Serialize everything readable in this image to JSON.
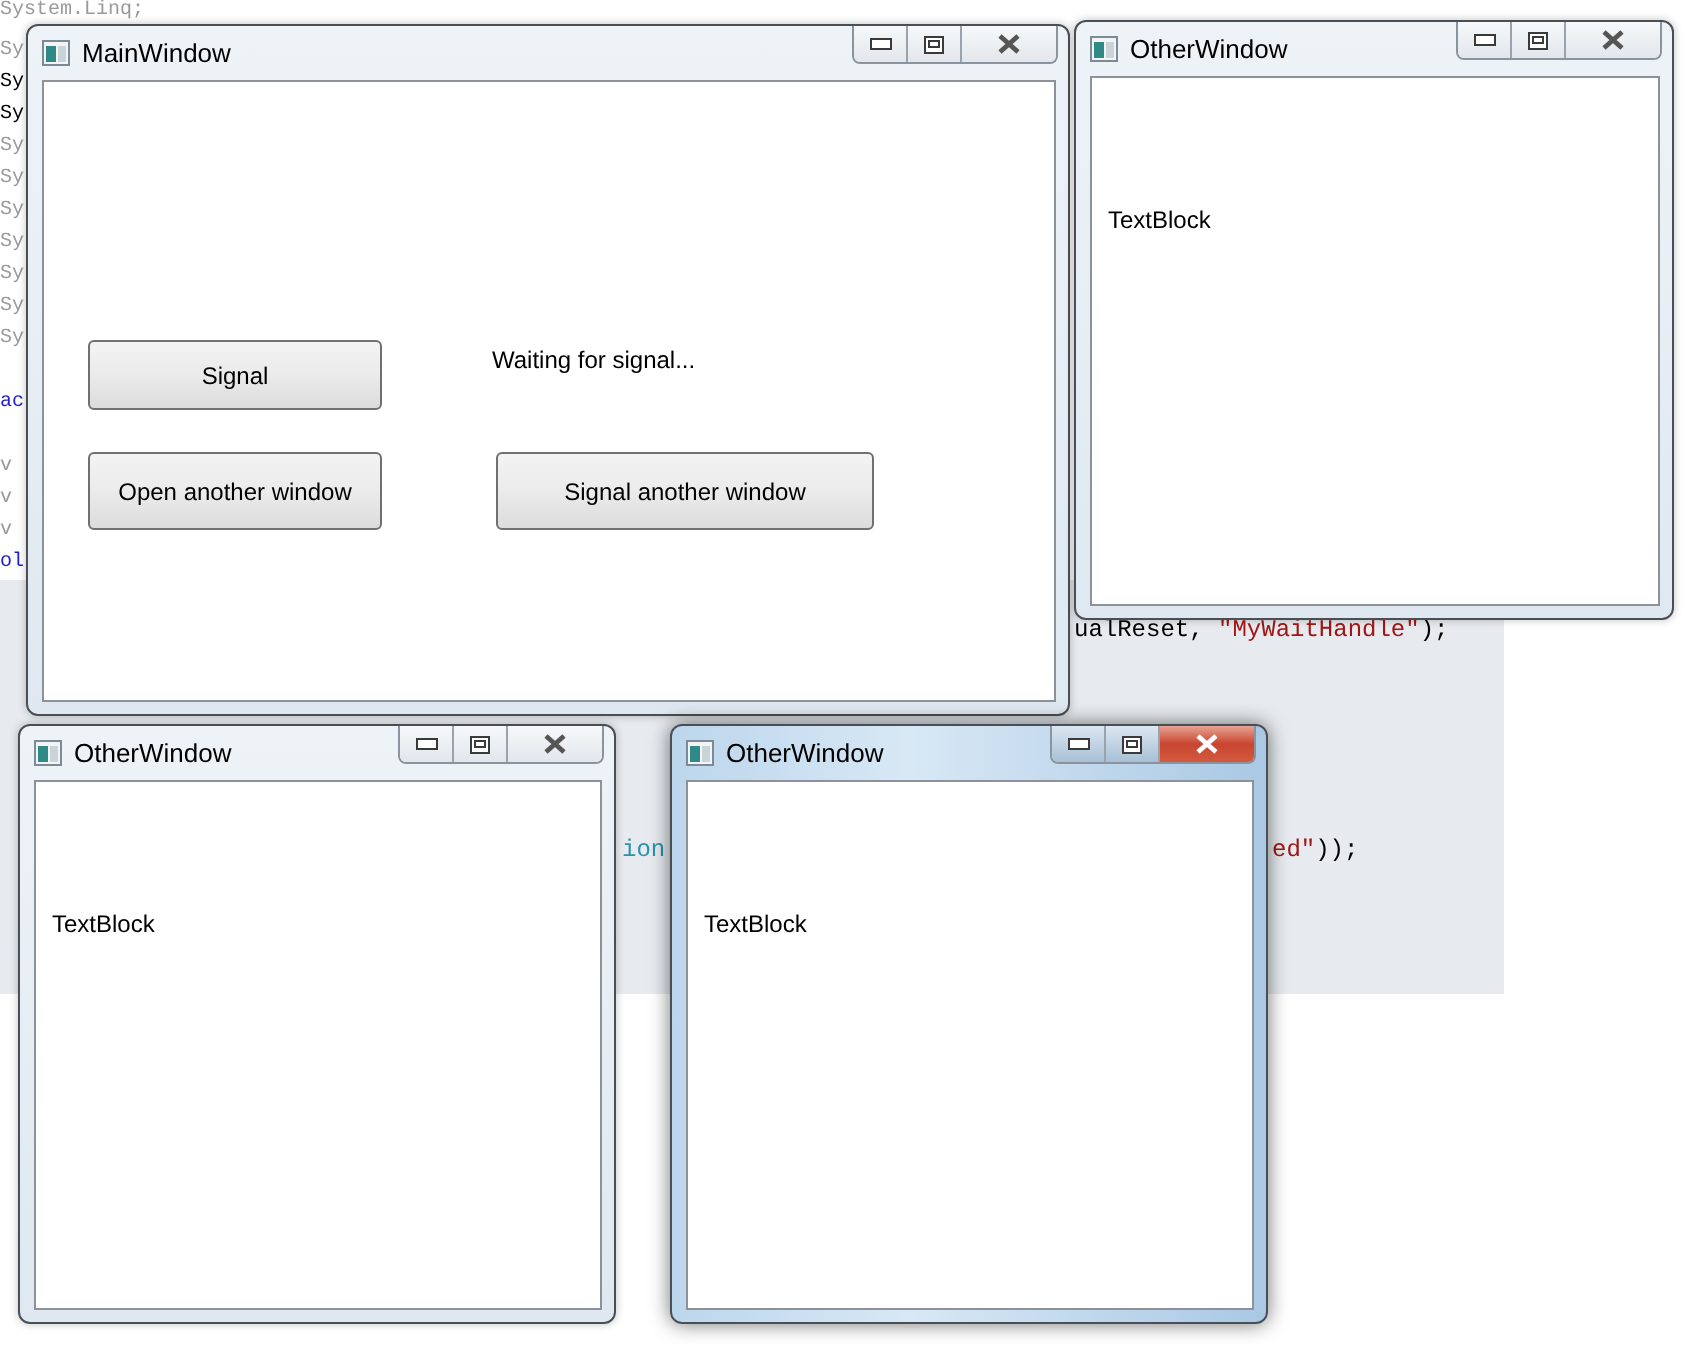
{
  "code_editor": {
    "lines": [
      {
        "segments": [
          {
            "text": "System.Linq;",
            "kind": "faded"
          }
        ]
      },
      {
        "segments": [
          {
            "text": "Sy",
            "kind": "faded"
          }
        ]
      },
      {
        "segments": [
          {
            "text": "Sy",
            "kind": "plain"
          }
        ]
      },
      {
        "segments": [
          {
            "text": "Sy",
            "kind": "plain"
          }
        ]
      },
      {
        "segments": [
          {
            "text": "Sy",
            "kind": "faded"
          }
        ]
      },
      {
        "segments": [
          {
            "text": "Sy",
            "kind": "faded"
          }
        ]
      },
      {
        "segments": [
          {
            "text": "Sy",
            "kind": "faded"
          }
        ]
      },
      {
        "segments": [
          {
            "text": "Sy",
            "kind": "faded"
          }
        ]
      },
      {
        "segments": [
          {
            "text": "Sy",
            "kind": "faded"
          }
        ]
      },
      {
        "segments": [
          {
            "text": "Sy",
            "kind": "faded"
          }
        ]
      },
      {
        "segments": [
          {
            "text": "Sy",
            "kind": "faded"
          }
        ]
      },
      {
        "segments": [
          {
            "text": "ac",
            "kind": "keyword"
          }
        ]
      },
      {
        "segments": [
          {
            "text": "v",
            "kind": "faded"
          }
        ]
      },
      {
        "segments": [
          {
            "text": "v",
            "kind": "faded"
          }
        ]
      },
      {
        "segments": [
          {
            "text": "v",
            "kind": "faded"
          }
        ]
      },
      {
        "segments": [
          {
            "text": "ol",
            "kind": "keyword"
          }
        ]
      },
      {
        "segments": [
          {
            "text": "ualReset, ",
            "kind": "plain"
          },
          {
            "text": "\"MyWaitHandle\"",
            "kind": "string"
          },
          {
            "text": ");",
            "kind": "plain"
          }
        ]
      },
      {
        "segments": [
          {
            "text": "ion",
            "kind": "type"
          }
        ]
      },
      {
        "segments": [
          {
            "text": "ed\"",
            "kind": "string"
          },
          {
            "text": "));",
            "kind": "plain"
          }
        ]
      }
    ]
  },
  "windows": [
    {
      "title": "MainWindow",
      "active": false,
      "content": {
        "kind": "main",
        "items": [
          {
            "kind": "button",
            "text": "Signal"
          },
          {
            "kind": "label",
            "text": "Waiting for signal..."
          },
          {
            "kind": "button",
            "text": "Open another window"
          },
          {
            "kind": "button",
            "text": "Signal another window"
          }
        ]
      }
    },
    {
      "title": "OtherWindow",
      "active": false,
      "content": {
        "kind": "text",
        "text": "TextBlock"
      }
    },
    {
      "title": "OtherWindow",
      "active": false,
      "content": {
        "kind": "text",
        "text": "TextBlock"
      }
    },
    {
      "title": "OtherWindow",
      "active": true,
      "content": {
        "kind": "text",
        "text": "TextBlock"
      }
    }
  ]
}
